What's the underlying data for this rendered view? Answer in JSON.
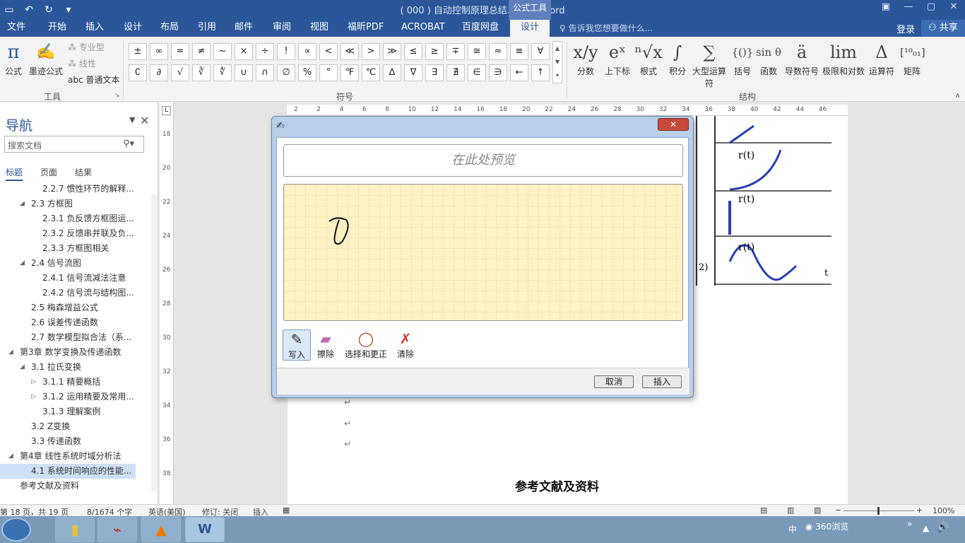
{
  "app": {
    "doc_title": "( 000 ) 自动控制原理总结.docx - Word",
    "context_tab": "公式工具",
    "tell_me": "告诉我您想要做什么...",
    "login": "登录",
    "share": "共享"
  },
  "tabs": [
    "文件",
    "开始",
    "插入",
    "设计",
    "布局",
    "引用",
    "邮件",
    "审阅",
    "视图",
    "福昕PDF",
    "ACROBAT",
    "百度网盘",
    "设计"
  ],
  "ribbon": {
    "tools": {
      "equation": "公式",
      "ink": "墨迹公式",
      "professional": "专业型",
      "linear": "线性",
      "normal_text": "abc 普通文本",
      "group": "工具"
    },
    "symbols_row1": [
      "±",
      "∞",
      "=",
      "≠",
      "~",
      "×",
      "÷",
      "!",
      "∝",
      "<",
      "≪",
      ">",
      "≫",
      "≤",
      "≥",
      "∓",
      "≅",
      "≈",
      "≡",
      "∀"
    ],
    "symbols_row2": [
      "∁",
      "∂",
      "√",
      "∛",
      "∜",
      "∪",
      "∩",
      "∅",
      "%",
      "°",
      "℉",
      "℃",
      "∆",
      "∇",
      "∃",
      "∄",
      "∈",
      "∋",
      "←",
      "↑"
    ],
    "symbols_group": "符号",
    "structures": [
      {
        "icon": "x/y",
        "label": "分数"
      },
      {
        "icon": "eˣ",
        "label": "上下标"
      },
      {
        "icon": "ⁿ√x",
        "label": "根式"
      },
      {
        "icon": "∫",
        "label": "积分"
      },
      {
        "icon": "∑",
        "label": "大型运算符"
      },
      {
        "icon": "{()}",
        "label": "括号"
      },
      {
        "icon": "sin θ",
        "label": "函数"
      },
      {
        "icon": "ä",
        "label": "导数符号"
      },
      {
        "icon": "lim",
        "label": "极限和对数"
      },
      {
        "icon": "Δ",
        "label": "运算符"
      },
      {
        "icon": "[¹⁰₀₁]",
        "label": "矩阵"
      }
    ],
    "structures_group": "结构"
  },
  "nav": {
    "title": "导航",
    "search_placeholder": "搜索文档",
    "tabs": [
      "标题",
      "页面",
      "结果"
    ],
    "items": [
      {
        "text": "2.2.7 惯性环节的解释...",
        "level": 3
      },
      {
        "text": "2.3  方框图",
        "level": 2,
        "expanded": true
      },
      {
        "text": "2.3.1 负反馈方框图运...",
        "level": 3
      },
      {
        "text": "2.3.2 反馈串并联及负...",
        "level": 3
      },
      {
        "text": "2.3.3 方框图相关",
        "level": 3
      },
      {
        "text": "2.4  信号流图",
        "level": 2,
        "expanded": true
      },
      {
        "text": "2.4.1 信号流减法注意",
        "level": 3
      },
      {
        "text": "2.4.2 信号流与结构图...",
        "level": 3
      },
      {
        "text": "2.5  梅森增益公式",
        "level": 2
      },
      {
        "text": "2.6  误差传递函数",
        "level": 2
      },
      {
        "text": "2.7  数学模型拟合法（系...",
        "level": 2
      },
      {
        "text": "第3章 数学变换及传递函数",
        "level": 1,
        "expanded": true
      },
      {
        "text": "3.1  拉氏变换",
        "level": 2,
        "expanded": true
      },
      {
        "text": "3.1.1 精要概括",
        "level": 3,
        "collapsed": true
      },
      {
        "text": "3.1.2 运用精要及常用...",
        "level": 3,
        "collapsed": true
      },
      {
        "text": "3.1.3 理解案例",
        "level": 3
      },
      {
        "text": "3.2  Z变换",
        "level": 2
      },
      {
        "text": "3.3  传递函数",
        "level": 2
      },
      {
        "text": "第4章 线性系统时域分析法",
        "level": 1,
        "expanded": true
      },
      {
        "text": "4.1  系统时间响应的性能...",
        "level": 2,
        "selected": true
      },
      {
        "text": "参考文献及资料",
        "level": 1
      }
    ]
  },
  "ruler_labels": [
    "2",
    "2",
    "4",
    "6",
    "8",
    "10",
    "12",
    "14",
    "16",
    "18",
    "20",
    "22",
    "24",
    "26",
    "28",
    "30",
    "32",
    "34",
    "36",
    "38",
    "40",
    "42",
    "44",
    "46"
  ],
  "vruler_labels": [
    "18",
    "20",
    "22",
    "24",
    "26",
    "28",
    "30",
    "32",
    "34",
    "36",
    "38"
  ],
  "document": {
    "heading": "参考文献及资料",
    "figure_labels": [
      "r(t)",
      "r(t)",
      "r(t)",
      "t",
      "2)"
    ],
    "para_mark": "↵"
  },
  "dialog": {
    "preview": "在此处预览",
    "tools": [
      "写入",
      "擦除",
      "选择和更正",
      "清除"
    ],
    "cancel": "取消",
    "insert": "插入"
  },
  "status": {
    "page": "第 18 页，共 19 页",
    "words": "8/1674 个字",
    "lang": "英语(美国)",
    "track": "修订: 关闭",
    "mode": "插入",
    "zoom": "100%"
  },
  "taskbar": {
    "ime": "中",
    "browser": "360浏览"
  }
}
